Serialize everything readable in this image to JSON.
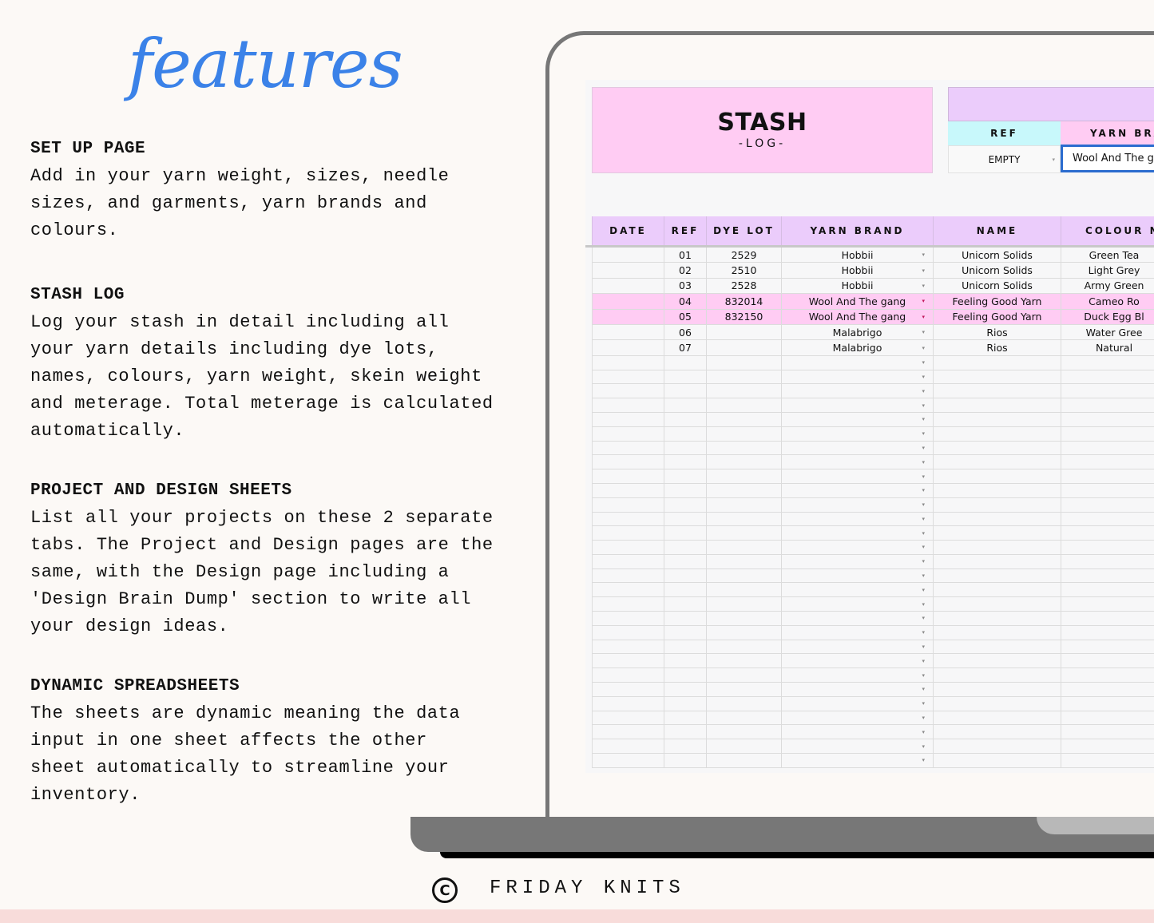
{
  "title": "features",
  "features": [
    {
      "heading": "SET UP PAGE",
      "body": "Add in your yarn weight, sizes, needle\nsizes, and garments, yarn brands and\ncolours."
    },
    {
      "heading": "STASH LOG",
      "body": "Log your stash in detail including all\nyour yarn details including dye lots,\nnames, colours, yarn weight, skein weight\nand meterage. Total meterage is calculated\nautomatically."
    },
    {
      "heading": "PROJECT AND DESIGN SHEETS",
      "body": "List all your projects on these 2 separate\ntabs. The Project and Design pages are the\nsame, with the Design page including a\n'Design Brain Dump' section to write all\nyour design ideas."
    },
    {
      "heading": "DYNAMIC  SPREADSHEETS",
      "body": "The sheets are dynamic meaning the data\ninput in one sheet affects the other\nsheet automatically to streamline your\ninventory."
    }
  ],
  "sheet": {
    "title": "STASH",
    "subtitle": "-LOG-",
    "lookup": {
      "ref_header": "REF",
      "brand_header": "YARN BRA",
      "ref_value": "EMPTY",
      "brand_value": "Wool And The g"
    },
    "columns": [
      "DATE",
      "REF",
      "DYE LOT",
      "YARN BRAND",
      "NAME",
      "COLOUR N"
    ],
    "rows": [
      {
        "date": "",
        "ref": "01",
        "dye_lot": "2529",
        "brand": "Hobbii",
        "name": "Unicorn Solids",
        "colour": "Green Tea",
        "highlight": false
      },
      {
        "date": "",
        "ref": "02",
        "dye_lot": "2510",
        "brand": "Hobbii",
        "name": "Unicorn Solids",
        "colour": "Light Grey",
        "highlight": false
      },
      {
        "date": "",
        "ref": "03",
        "dye_lot": "2528",
        "brand": "Hobbii",
        "name": "Unicorn Solids",
        "colour": "Army Green",
        "highlight": false
      },
      {
        "date": "",
        "ref": "04",
        "dye_lot": "832014",
        "brand": "Wool And The gang",
        "name": "Feeling Good Yarn",
        "colour": "Cameo Ro",
        "highlight": true
      },
      {
        "date": "",
        "ref": "05",
        "dye_lot": "832150",
        "brand": "Wool And The gang",
        "name": "Feeling Good Yarn",
        "colour": "Duck Egg Bl",
        "highlight": true
      },
      {
        "date": "",
        "ref": "06",
        "dye_lot": "",
        "brand": "Malabrigo",
        "name": "Rios",
        "colour": "Water Gree",
        "highlight": false
      },
      {
        "date": "",
        "ref": "07",
        "dye_lot": "",
        "brand": "Malabrigo",
        "name": "Rios",
        "colour": "Natural",
        "highlight": false
      }
    ],
    "empty_row_count": 29,
    "dropdown_icon": "▾"
  },
  "footer": {
    "copyright_symbol": "C",
    "brand": "FRIDAY KNITS"
  },
  "colors": {
    "title_blue": "#3b82e8",
    "pink": "#ffccf3",
    "lilac": "#ebccfb",
    "cyan": "#c8f8fb",
    "selection_blue": "#2b6ccf"
  }
}
